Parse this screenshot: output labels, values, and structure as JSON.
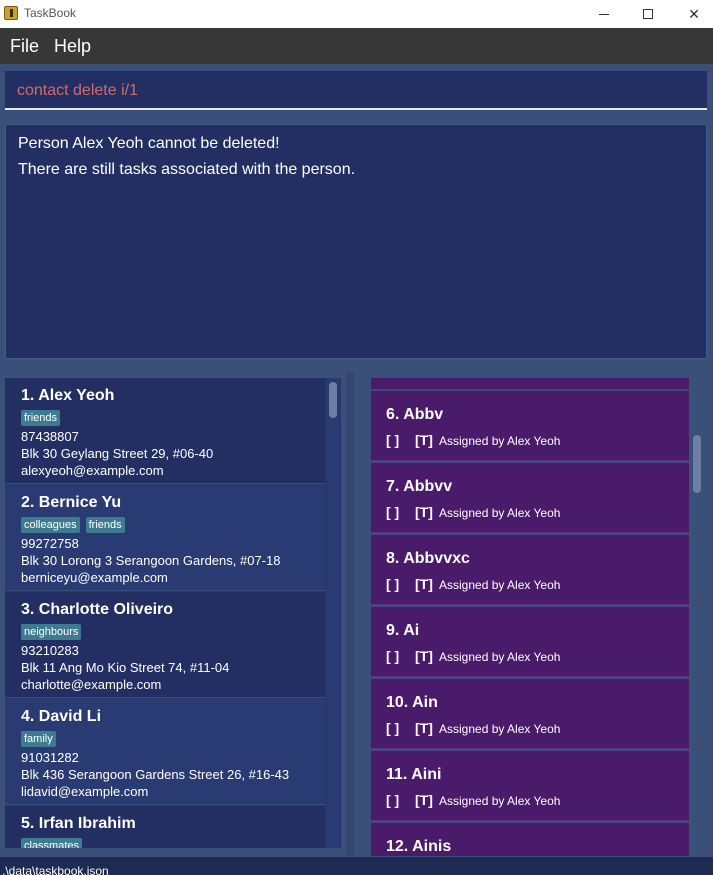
{
  "window": {
    "title": "TaskBook"
  },
  "menu": {
    "file": "File",
    "help": "Help"
  },
  "command": {
    "value": "contact delete i/1"
  },
  "result": {
    "line1": "Person Alex Yeoh cannot be deleted!",
    "line2": "There are still tasks associated with the person."
  },
  "persons": [
    {
      "name": "1.  Alex Yeoh",
      "tags": [
        "friends"
      ],
      "phone": "87438807",
      "address": "Blk 30 Geylang Street 29, #06-40",
      "email": "alexyeoh@example.com"
    },
    {
      "name": "2.  Bernice Yu",
      "tags": [
        "colleagues",
        "friends"
      ],
      "phone": "99272758",
      "address": "Blk 30 Lorong 3 Serangoon Gardens, #07-18",
      "email": "berniceyu@example.com"
    },
    {
      "name": "3.  Charlotte Oliveiro",
      "tags": [
        "neighbours"
      ],
      "phone": "93210283",
      "address": "Blk 11 Ang Mo Kio Street 74, #11-04",
      "email": "charlotte@example.com"
    },
    {
      "name": "4.  David Li",
      "tags": [
        "family"
      ],
      "phone": "91031282",
      "address": "Blk 436 Serangoon Gardens Street 26, #16-43",
      "email": "lidavid@example.com"
    },
    {
      "name": "5.  Irfan Ibrahim",
      "tags": [
        "classmates"
      ],
      "phone": "",
      "address": "",
      "email": ""
    }
  ],
  "tasks": [
    {
      "name": "6.  Abbv",
      "status": "[  ]",
      "type": "[T]",
      "assigned": "Assigned by  Alex Yeoh"
    },
    {
      "name": "7.  Abbvv",
      "status": "[  ]",
      "type": "[T]",
      "assigned": "Assigned by  Alex Yeoh"
    },
    {
      "name": "8.  Abbvvxc",
      "status": "[  ]",
      "type": "[T]",
      "assigned": "Assigned by  Alex Yeoh"
    },
    {
      "name": "9.  Ai",
      "status": "[  ]",
      "type": "[T]",
      "assigned": "Assigned by  Alex Yeoh"
    },
    {
      "name": "10.  Ain",
      "status": "[  ]",
      "type": "[T]",
      "assigned": "Assigned by  Alex Yeoh"
    },
    {
      "name": "11.  Aini",
      "status": "[  ]",
      "type": "[T]",
      "assigned": "Assigned by  Alex Yeoh"
    },
    {
      "name": "12.  Ainis",
      "status": "",
      "type": "",
      "assigned": ""
    }
  ],
  "status_bar": {
    "path": ".\\data\\taskbook.json"
  },
  "colors": {
    "background": "#3b5078",
    "panel": "#232f63",
    "task_card": "#4a1a6b",
    "tag": "#3e7b91",
    "command_text": "#d06a6a"
  }
}
